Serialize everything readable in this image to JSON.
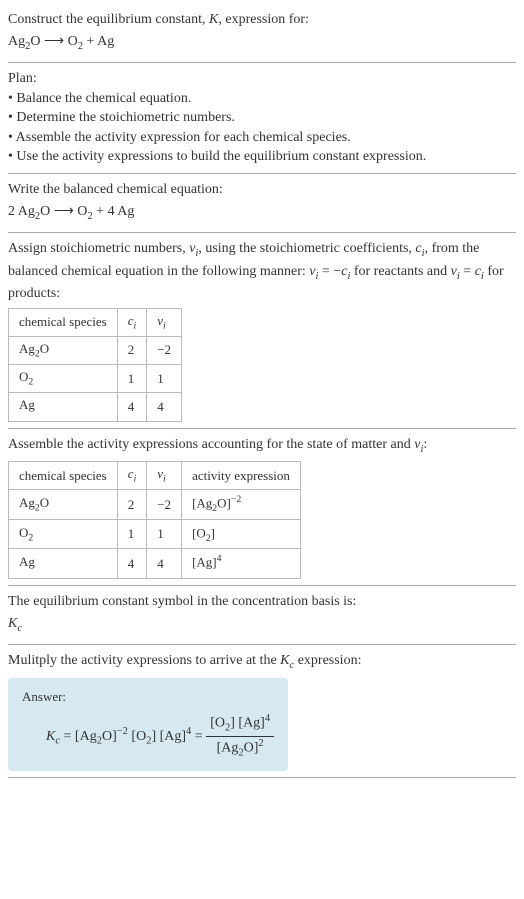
{
  "header": {
    "prompt": "Construct the equilibrium constant, ",
    "K": "K",
    "prompt2": ", expression for:",
    "reaction_lhs": "Ag",
    "reaction_sub1": "2",
    "reaction_o": "O",
    "arrow": " ⟶ ",
    "reaction_rhs1": "O",
    "reaction_sub2": "2",
    "plus": " + ",
    "reaction_rhs2": "Ag"
  },
  "plan": {
    "title": "Plan:",
    "b1": "• Balance the chemical equation.",
    "b2": "• Determine the stoichiometric numbers.",
    "b3": "• Assemble the activity expression for each chemical species.",
    "b4": "• Use the activity expressions to build the equilibrium constant expression."
  },
  "balanced": {
    "title": "Write the balanced chemical equation:",
    "c1": "2 Ag",
    "s1": "2",
    "c2": "O",
    "arrow": " ⟶ ",
    "c3": "O",
    "s2": "2",
    "plus": " + ",
    "c4": "4 Ag"
  },
  "stoich": {
    "intro1": "Assign stoichiometric numbers, ",
    "nu": "ν",
    "i": "i",
    "intro2": ", using the stoichiometric coefficients, ",
    "c": "c",
    "intro3": ", from the balanced chemical equation in the following manner: ",
    "rel1a": "ν",
    "rel1b": " = −",
    "rel1c": "c",
    "rel1d": " for reactants and ",
    "rel2a": "ν",
    "rel2b": " = ",
    "rel2c": "c",
    "rel2d": " for products:",
    "headers": {
      "h1": "chemical species",
      "h2": "c",
      "h2i": "i",
      "h3": "ν",
      "h3i": "i"
    },
    "rows": [
      {
        "sp_a": "Ag",
        "sp_s": "2",
        "sp_b": "O",
        "c": "2",
        "nu": "−2"
      },
      {
        "sp_a": "O",
        "sp_s": "2",
        "sp_b": "",
        "c": "1",
        "nu": "1"
      },
      {
        "sp_a": "Ag",
        "sp_s": "",
        "sp_b": "",
        "c": "4",
        "nu": "4"
      }
    ]
  },
  "activity": {
    "intro1": "Assemble the activity expressions accounting for the state of matter and ",
    "nu": "ν",
    "i": "i",
    "intro2": ":",
    "headers": {
      "h1": "chemical species",
      "h2": "c",
      "h2i": "i",
      "h3": "ν",
      "h3i": "i",
      "h4": "activity expression"
    },
    "rows": [
      {
        "sp_a": "Ag",
        "sp_s": "2",
        "sp_b": "O",
        "c": "2",
        "nu": "−2",
        "act_a": "[Ag",
        "act_s": "2",
        "act_b": "O]",
        "act_p": "−2"
      },
      {
        "sp_a": "O",
        "sp_s": "2",
        "sp_b": "",
        "c": "1",
        "nu": "1",
        "act_a": "[O",
        "act_s": "2",
        "act_b": "]",
        "act_p": ""
      },
      {
        "sp_a": "Ag",
        "sp_s": "",
        "sp_b": "",
        "c": "4",
        "nu": "4",
        "act_a": "[Ag]",
        "act_s": "",
        "act_b": "",
        "act_p": "4"
      }
    ]
  },
  "symbol": {
    "line": "The equilibrium constant symbol in the concentration basis is:",
    "K": "K",
    "c": "c"
  },
  "multiply": {
    "line1": "Mulitply the activity expressions to arrive at the ",
    "K": "K",
    "c": "c",
    "line2": " expression:"
  },
  "answer": {
    "label": "Answer:",
    "K": "K",
    "c": "c",
    "eq": " = ",
    "t1a": "[Ag",
    "t1s": "2",
    "t1b": "O]",
    "t1p": "−2",
    "sp": " ",
    "t2a": "[O",
    "t2s": "2",
    "t2b": "]",
    "t3a": "[Ag]",
    "t3p": "4",
    "eq2": " = ",
    "num1a": "[O",
    "num1s": "2",
    "num1b": "]",
    "num2a": " [Ag]",
    "num2p": "4",
    "den1a": "[Ag",
    "den1s": "2",
    "den1b": "O]",
    "den1p": "2"
  }
}
